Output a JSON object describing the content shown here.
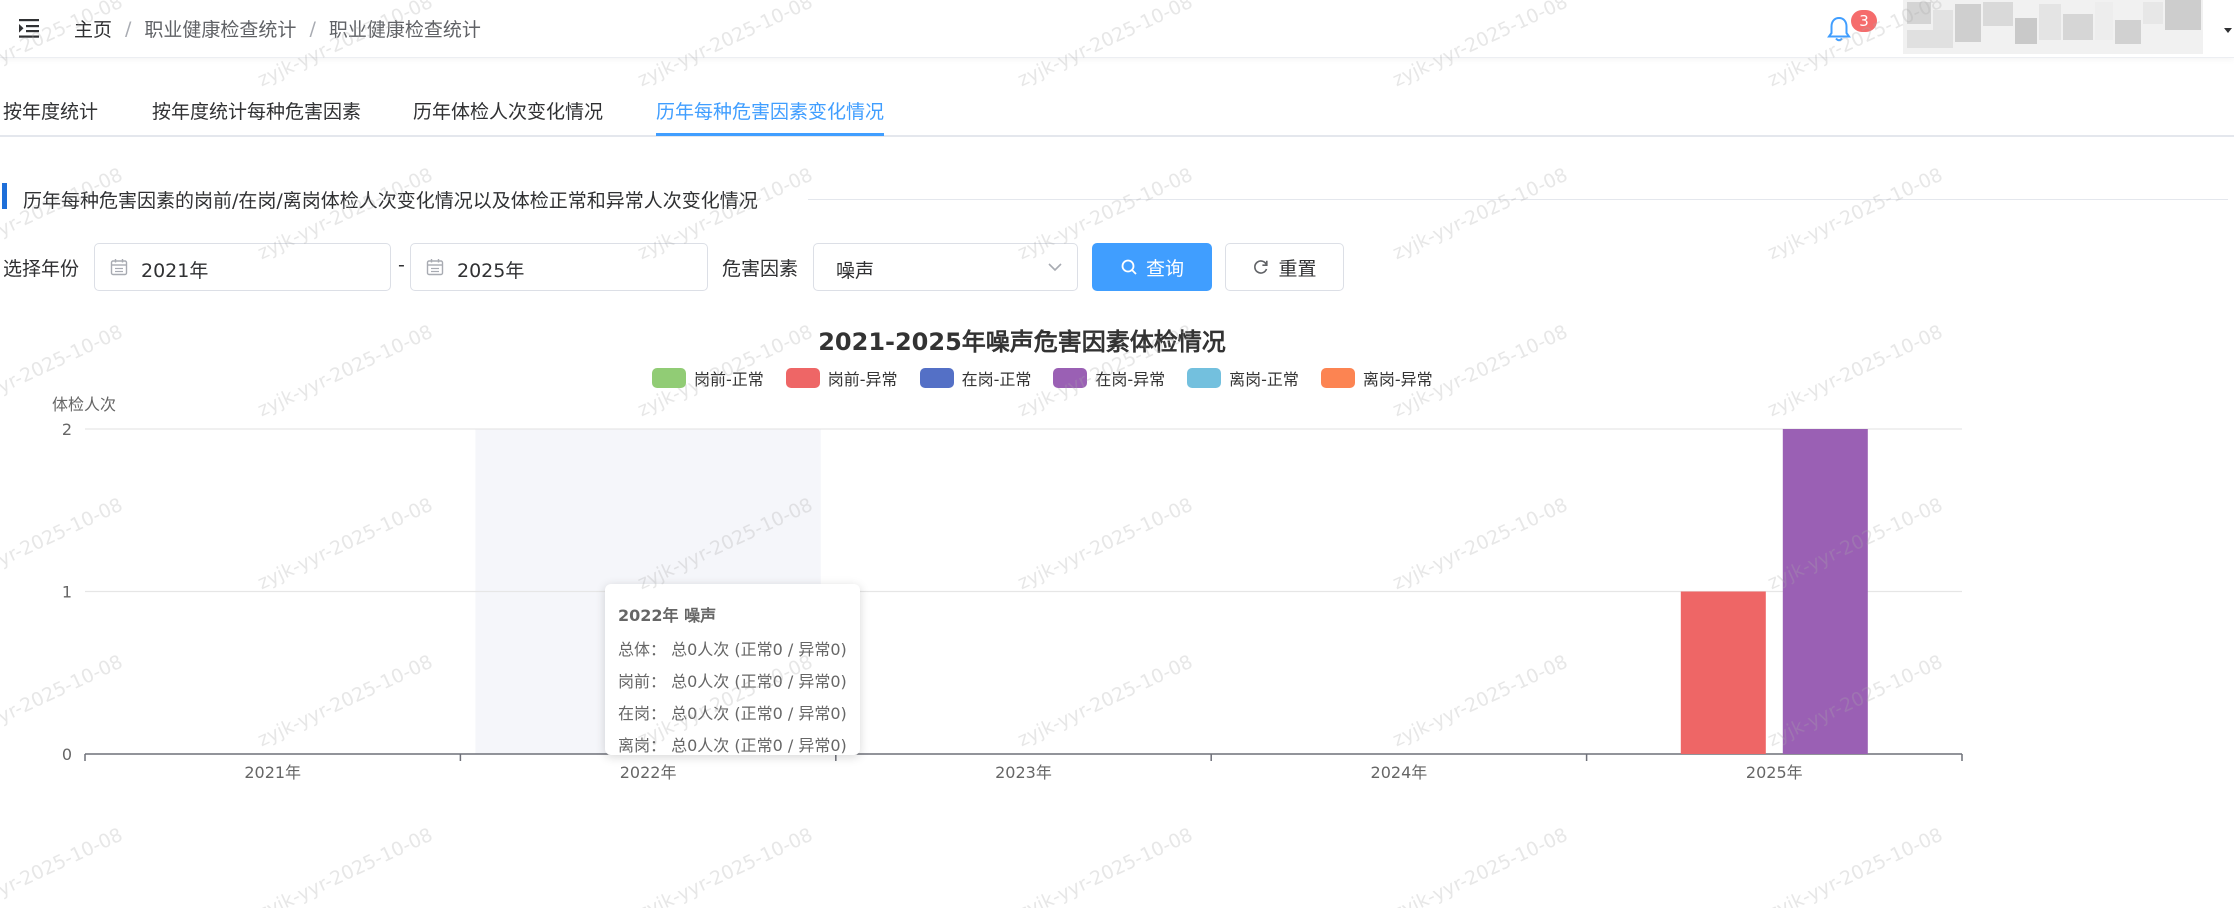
{
  "header": {
    "breadcrumb": [
      "主页",
      "职业健康检查统计",
      "职业健康检查统计"
    ],
    "notification_count": "3"
  },
  "tabs": [
    {
      "label": "按年度统计",
      "active": false
    },
    {
      "label": "按年度统计每种危害因素",
      "active": false
    },
    {
      "label": "历年体检人次变化情况",
      "active": false
    },
    {
      "label": "历年每种危害因素变化情况",
      "active": true
    }
  ],
  "section": {
    "title": "历年每种危害因素的岗前/在岗/离岗体检人次变化情况以及体检正常和异常人次变化情况"
  },
  "filters": {
    "year_label": "选择年份",
    "start_year": "2021年",
    "range_separator": "-",
    "end_year": "2025年",
    "hazard_label": "危害因素",
    "hazard_value": "噪声",
    "query_button": "查询",
    "reset_button": "重置"
  },
  "watermark": "zyjk-yyr-2025-10-08",
  "chart_data": {
    "type": "bar",
    "title": "2021-2025年噪声危害因素体检情况",
    "ylabel": "体检人次",
    "ylim": [
      0,
      2
    ],
    "yticks": [
      "0",
      "1",
      "2"
    ],
    "categories": [
      "2021年",
      "2022年",
      "2023年",
      "2024年",
      "2025年"
    ],
    "legend_position": "top-center",
    "grid": true,
    "highlighted_category": "2022年",
    "series": [
      {
        "name": "岗前-正常",
        "color": "#91cc75",
        "values": [
          0,
          0,
          0,
          0,
          0
        ]
      },
      {
        "name": "岗前-异常",
        "color": "#ee6666",
        "values": [
          0,
          0,
          0,
          0,
          1
        ]
      },
      {
        "name": "在岗-正常",
        "color": "#5470c6",
        "values": [
          0,
          0,
          0,
          0,
          0
        ]
      },
      {
        "name": "在岗-异常",
        "color": "#9a60b4",
        "values": [
          0,
          0,
          0,
          0,
          2
        ]
      },
      {
        "name": "离岗-正常",
        "color": "#73c0de",
        "values": [
          0,
          0,
          0,
          0,
          0
        ]
      },
      {
        "name": "离岗-异常",
        "color": "#fc8452",
        "values": [
          0,
          0,
          0,
          0,
          0
        ]
      }
    ],
    "tooltip": {
      "title": "2022年 噪声",
      "rows": [
        "总体： 总0人次 (正常0 / 异常0)",
        "岗前： 总0人次 (正常0 / 异常0)",
        "在岗： 总0人次 (正常0 / 异常0)",
        "离岗： 总0人次 (正常0 / 异常0)"
      ]
    }
  }
}
